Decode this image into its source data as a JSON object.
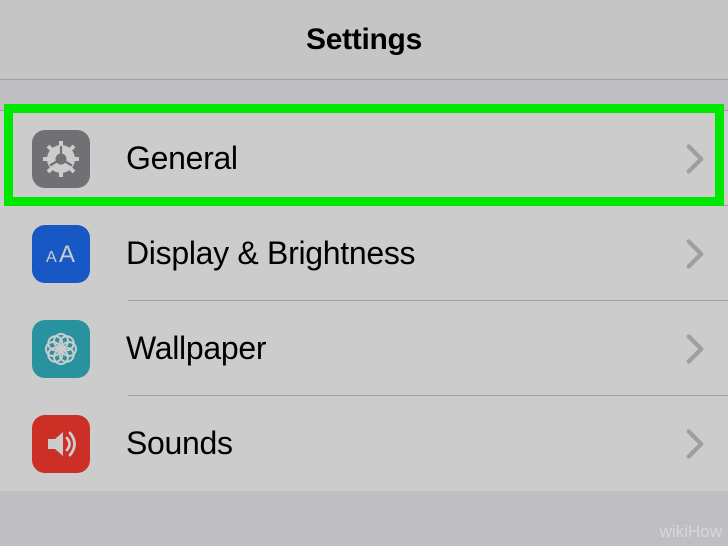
{
  "header": {
    "title": "Settings"
  },
  "rows": [
    {
      "label": "General",
      "icon": "gear-icon",
      "color": "bg-gray"
    },
    {
      "label": "Display & Brightness",
      "icon": "display-icon",
      "color": "bg-blue"
    },
    {
      "label": "Wallpaper",
      "icon": "wallpaper-icon",
      "color": "bg-teal"
    },
    {
      "label": "Sounds",
      "icon": "sounds-icon",
      "color": "bg-red"
    }
  ],
  "highlight_index": 0,
  "watermark": "wikiHow"
}
